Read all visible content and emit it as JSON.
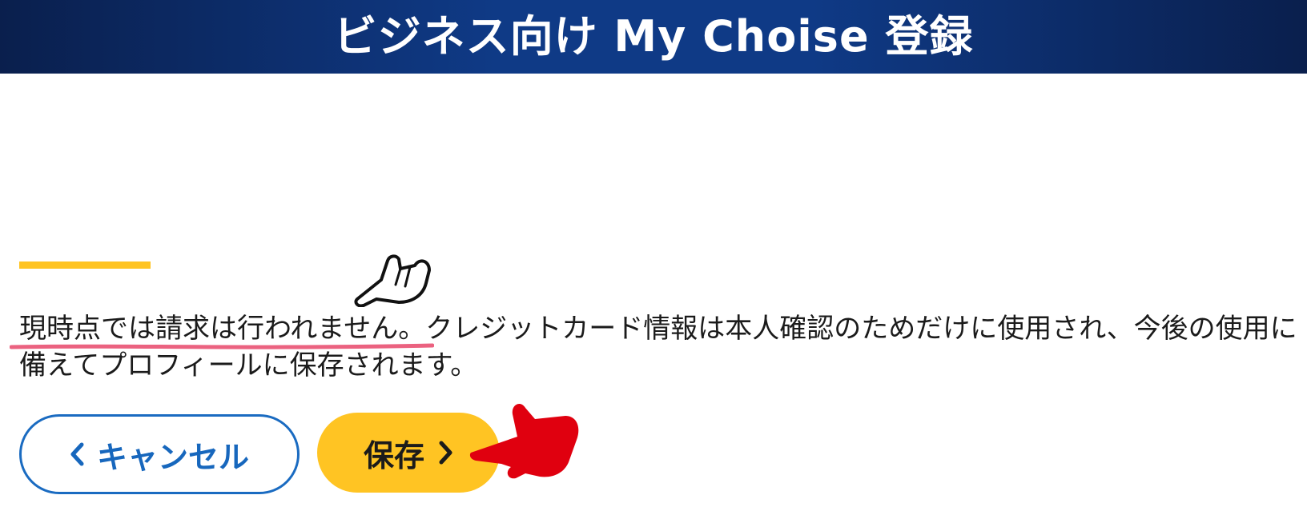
{
  "header": {
    "title": "ビジネス向け My Choise 登録"
  },
  "message": {
    "highlighted": "現時点では請求は行われません",
    "rest": "。クレジットカード情報は本人確認のためだけに使用され、今後の使用に備えてプロフィールに保存されます。"
  },
  "buttons": {
    "cancel_label": "キャンセル",
    "save_label": "保存"
  },
  "colors": {
    "banner": "#0f3a86",
    "accent": "#ffc423",
    "cancel_border": "#1a6bc1",
    "pointer_red": "#e0000f",
    "underline": "#e8476a"
  },
  "icons": {
    "outline_pointer": "pointing-hand-outline-icon",
    "red_pointer": "pointing-hand-red-icon",
    "cancel_chevron": "chevron-left-icon",
    "save_chevron": "chevron-right-icon"
  }
}
